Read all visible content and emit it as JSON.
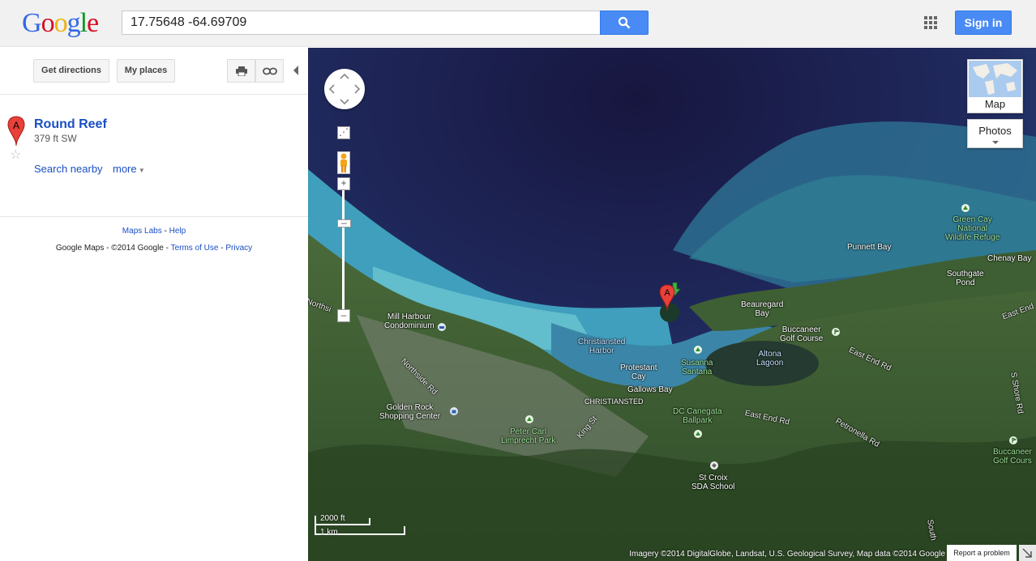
{
  "header": {
    "logo": [
      "G",
      "o",
      "o",
      "g",
      "l",
      "e"
    ],
    "logo_colors": [
      "#3369e8",
      "#d50f25",
      "#eeb211",
      "#3369e8",
      "#009925",
      "#d50f25"
    ],
    "search_value": "17.75648  -64.69709",
    "search_icon": "search-icon",
    "apps_icon": "apps-grid-icon",
    "signin_label": "Sign in"
  },
  "panel": {
    "get_directions": "Get directions",
    "my_places": "My places",
    "print_icon": "print-icon",
    "link_icon": "link-icon",
    "result": {
      "marker": "A",
      "title": "Round Reef",
      "distance": "379 ft SW",
      "search_nearby": "Search nearby",
      "more": "more"
    },
    "footer": {
      "maps_labs": "Maps Labs",
      "sep1": " - ",
      "help": "Help",
      "copyright": "Google Maps - ©2014 Google - ",
      "terms": "Terms of Use",
      "sep2": " - ",
      "privacy": "Privacy"
    }
  },
  "map": {
    "marker_label": "A",
    "labels": {
      "green_cay": "Green Cay\nNational\nWildlife Refuge",
      "punnett_bay": "Punnett Bay",
      "chenay_bay": "Chenay Bay",
      "southgate_pond": "Southgate\nPond",
      "east_end_rd_1": "East End",
      "beauregard_bay": "Beauregard\nBay",
      "buccaneer_golf": "Buccaneer\nGolf Course",
      "east_end_rd_2": "East End Rd",
      "mill_harbour": "Mill Harbour\nCondominium",
      "christiansted_harbor": "Christiansted\nHarbor",
      "susanna_santana": "Susanna\nSantana",
      "altona_lagoon": "Altona\nLagoon",
      "northside_rd": "Northside Rd",
      "north_rd": "Northsi",
      "protestant_cay": "Protestant\nCay",
      "gallows_bay": "Gallows Bay",
      "christiansted": "CHRISTIANSTED",
      "s_shore_rd": "S Shore Rd",
      "golden_rock": "Golden Rock\nShopping Center",
      "dc_canegata": "DC Canegata\nBallpark",
      "east_end_rd_3": "East End Rd",
      "petronella_rd": "Petronella Rd",
      "peter_carl": "Peter Carl\nLimprecht Park",
      "king_st": "King St",
      "buccaneer_golf_2": "Buccaneer\nGolf Cours",
      "st_croix_sda": "St Croix\nSDA School",
      "south": "South"
    },
    "map_type": "Map",
    "photos": "Photos",
    "scale_ft": "2000 ft",
    "scale_km": "1 km",
    "attribution": "Imagery ©2014 DigitalGlobe, Landsat, U.S. Geological Survey, Map data ©2014 Google",
    "report": "Report a problem"
  }
}
